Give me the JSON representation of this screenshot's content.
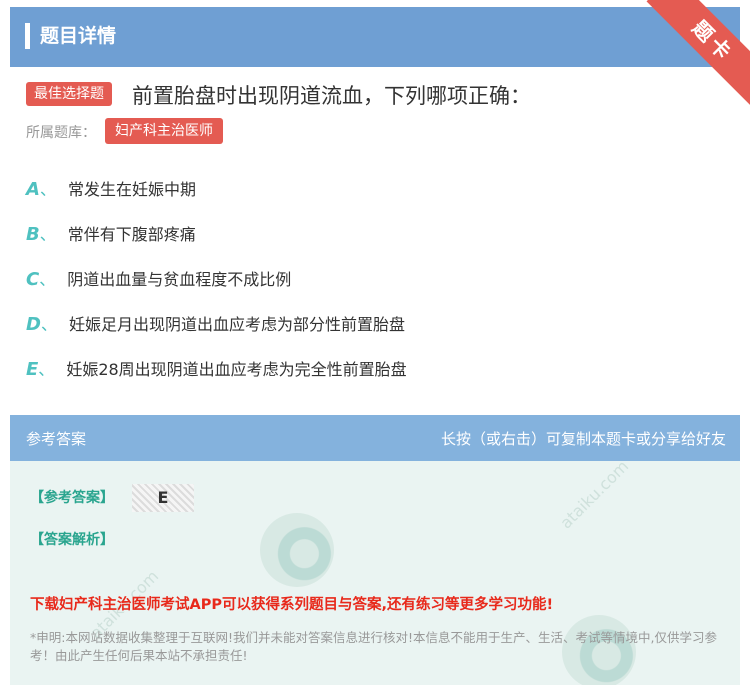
{
  "header": {
    "title": "题目详情",
    "ribbon": "题卡"
  },
  "question": {
    "type_tag": "最佳选择题",
    "text": "前置胎盘时出现阴道流血，下列哪项正确：",
    "bank_label": "所属题库：",
    "bank_name": "妇产科主治医师"
  },
  "options": [
    {
      "letter": "A",
      "sep": "、",
      "text": "常发生在妊娠中期"
    },
    {
      "letter": "B",
      "sep": "、",
      "text": "常伴有下腹部疼痛"
    },
    {
      "letter": "C",
      "sep": "、",
      "text": "阴道出血量与贫血程度不成比例"
    },
    {
      "letter": "D",
      "sep": "、",
      "text": "妊娠足月出现阴道出血应考虑为部分性前置胎盘"
    },
    {
      "letter": "E",
      "sep": "、",
      "text": "妊娠28周出现阴道出血应考虑为完全性前置胎盘"
    }
  ],
  "answer": {
    "section_title": "参考答案",
    "hint": "长按（或右击）可复制本题卡或分享给好友",
    "answer_label": "【参考答案】",
    "answer_value": "E",
    "explanation_label": "【答案解析】",
    "download_text": "下载妇产科主治医师考试APP可以获得系列题目与答案,还有练习等更多学习功能!",
    "disclaimer": "*申明:本网站数据收集整理于互联网!我们并未能对答案信息进行核对!本信息不能用于生产、生活、考试等情境中,仅供学习参考！由此产生任何后果本站不承担责任!"
  },
  "watermark": {
    "text": "ataiku.com"
  }
}
